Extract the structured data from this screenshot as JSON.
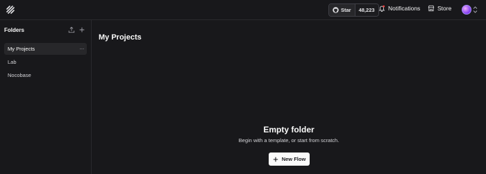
{
  "topbar": {
    "github": {
      "star_label": "Star",
      "star_count": "48,223"
    },
    "notifications_label": "Notifications",
    "store_label": "Store"
  },
  "sidebar": {
    "title": "Folders",
    "items": [
      {
        "label": "My Projects",
        "active": true
      },
      {
        "label": "Lab",
        "active": false
      },
      {
        "label": "Nocobase",
        "active": false
      }
    ],
    "more_glyph": "···"
  },
  "main": {
    "title": "My Projects",
    "empty_title": "Empty folder",
    "empty_subtitle": "Begin with a template, or start from scratch.",
    "new_flow_label": "New Flow"
  },
  "colors": {
    "background": "#18181b",
    "panel_active": "#27272a",
    "primary_button": "#fafafa",
    "notification_dot": "#ef4444",
    "avatar_accent": "#7c3aed"
  }
}
